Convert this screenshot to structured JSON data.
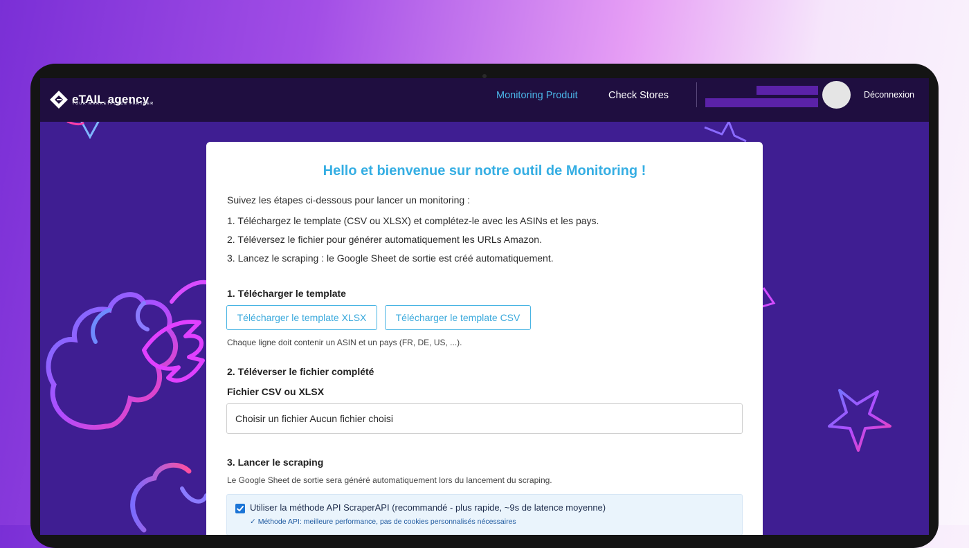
{
  "brand": {
    "name": "eTAIL agency",
    "tagline": "YOUR MARKETPLACE PARTNER"
  },
  "nav": {
    "items": [
      {
        "label": "Monitoring Produit",
        "active": true
      },
      {
        "label": "Check Stores",
        "active": false
      }
    ],
    "logout_label": "Déconnexion"
  },
  "card": {
    "title": "Hello et bienvenue sur notre outil de Monitoring !",
    "intro": "Suivez les étapes ci-dessous pour lancer un monitoring :",
    "steps": [
      "1. Téléchargez le template (CSV ou XLSX) et complétez-le avec les ASINs et les pays.",
      "2. Téléversez le fichier pour générer automatiquement les URLs Amazon.",
      "3. Lancez le scraping : le Google Sheet de sortie est créé automatiquement."
    ],
    "section1": {
      "title": "1. Télécharger le template",
      "btn_xlsx": "Télécharger le template XLSX",
      "btn_csv": "Télécharger le template CSV",
      "hint": "Chaque ligne doit contenir un ASIN et un pays (FR, DE, US, ...)."
    },
    "section2": {
      "title": "2. Téléverser le fichier complété",
      "field_label": "Fichier CSV ou XLSX",
      "file_input": "Choisir un fichier Aucun fichier choisi"
    },
    "section3": {
      "title": "3. Lancer le scraping",
      "hint": "Le Google Sheet de sortie sera généré automatiquement lors du lancement du scraping.",
      "api_checkbox_label": "Utiliser la méthode API ScraperAPI (recommandé - plus rapide, ~9s de latence moyenne)",
      "api_checked": true,
      "api_note": "✓ Méthode API: meilleure performance, pas de cookies personnalisés nécessaires"
    }
  },
  "colors": {
    "accent": "#35aee3",
    "topbar": "#1f0e40",
    "screen_bg": "#3e1f8e",
    "checkbox": "#1b74d6"
  }
}
